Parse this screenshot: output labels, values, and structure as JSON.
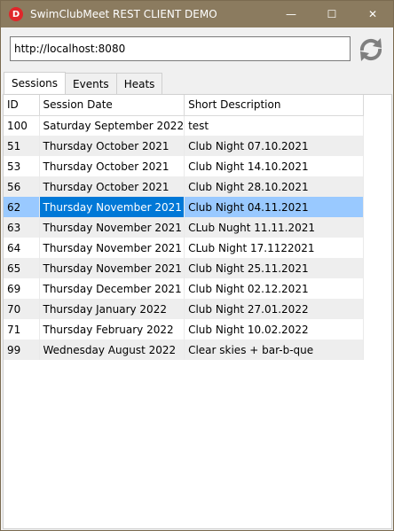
{
  "window": {
    "title": "SwimClubMeet REST CLIENT DEMO",
    "app_icon_letter": "D",
    "minimize": "—",
    "maximize": "☐",
    "close": "✕"
  },
  "url": {
    "value": "http://localhost:8080"
  },
  "tabs": [
    {
      "label": "Sessions",
      "active": true
    },
    {
      "label": "Events",
      "active": false
    },
    {
      "label": "Heats",
      "active": false
    }
  ],
  "grid": {
    "columns": [
      "ID",
      "Session Date",
      "Short Description"
    ],
    "selected_id": "62",
    "rows": [
      {
        "id": "100",
        "date": "Saturday September 2022",
        "desc": "test"
      },
      {
        "id": "51",
        "date": "Thursday October 2021",
        "desc": "Club Night 07.10.2021"
      },
      {
        "id": "53",
        "date": "Thursday October 2021",
        "desc": "Club Night 14.10.2021"
      },
      {
        "id": "56",
        "date": "Thursday October 2021",
        "desc": "Club Night 28.10.2021"
      },
      {
        "id": "62",
        "date": "Thursday November 2021",
        "desc": "Club Night 04.11.2021"
      },
      {
        "id": "63",
        "date": "Thursday November 2021",
        "desc": "CLub Nught 11.11.2021"
      },
      {
        "id": "64",
        "date": "Thursday November 2021",
        "desc": "CLub Night 17.1122021"
      },
      {
        "id": "65",
        "date": "Thursday November 2021",
        "desc": "Club Night 25.11.2021"
      },
      {
        "id": "69",
        "date": "Thursday December 2021",
        "desc": "Club Night 02.12.2021"
      },
      {
        "id": "70",
        "date": "Thursday January 2022",
        "desc": "Club Night 27.01.2022"
      },
      {
        "id": "71",
        "date": "Thursday February 2022",
        "desc": "Club Night 10.02.2022"
      },
      {
        "id": "99",
        "date": "Wednesday August 2022",
        "desc": "Clear skies + bar-b-que"
      }
    ]
  },
  "colors": {
    "titlebar": "#8b7b5f",
    "selection_cell": "#0078d7",
    "selection_row": "#99c9ff",
    "alt_row": "#eeeeee"
  },
  "icons": {
    "refresh": "refresh-icon"
  }
}
